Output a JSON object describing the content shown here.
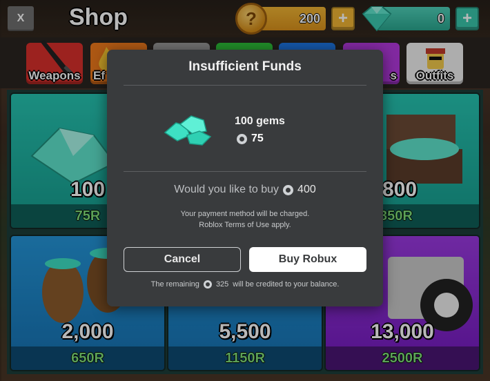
{
  "header": {
    "close_label": "X",
    "title": "Shop",
    "coins": "200",
    "coin_symbol": "?",
    "gems": "0",
    "plus_label": "+"
  },
  "tabs": [
    {
      "label": "Weapons",
      "color": "#d8302c"
    },
    {
      "label": "Ef",
      "color": "#f07a1c"
    },
    {
      "label": "",
      "color": "#9a9a9a"
    },
    {
      "label": "",
      "color": "#2fc23a"
    },
    {
      "label": "",
      "color": "#1e78e6"
    },
    {
      "label": "s",
      "color": "#b43ae0"
    },
    {
      "label": "Outfits",
      "color": "#f0f0f0"
    }
  ],
  "cards": [
    {
      "amount": "100",
      "price": "75R",
      "theme": "teal"
    },
    {
      "amount": "800",
      "price": "350R",
      "theme": "teal"
    },
    {
      "amount": "2,000",
      "price": "650R",
      "theme": "blue"
    },
    {
      "amount": "5,500",
      "price": "1150R",
      "theme": "blue"
    },
    {
      "amount": "13,000",
      "price": "2500R",
      "theme": "purple"
    }
  ],
  "modal": {
    "title": "Insufficient Funds",
    "item_name": "100 gems",
    "item_price": "75",
    "question": "Would you like to buy",
    "robux_amount": "400",
    "note1": "Your payment method will be charged.",
    "note2": "Roblox Terms of Use apply.",
    "cancel_label": "Cancel",
    "buy_label": "Buy Robux",
    "credit_prefix": "The remaining",
    "credit_amount": "325",
    "credit_suffix": "will be credited to your balance."
  }
}
